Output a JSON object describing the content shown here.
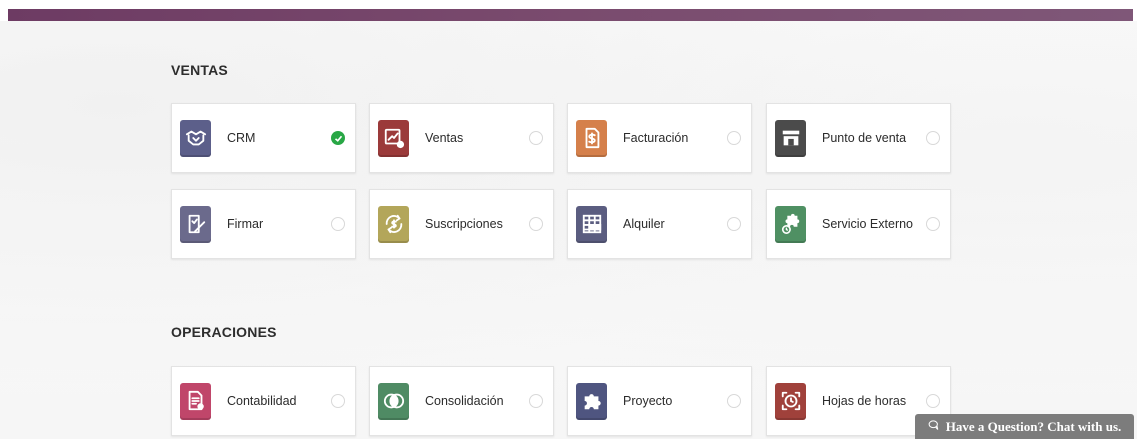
{
  "sections": [
    {
      "title": "VENTAS"
    },
    {
      "title": "OPERACIONES"
    }
  ],
  "apps": {
    "crm": {
      "label": "CRM",
      "installed": true,
      "icon": "handshake-icon",
      "color": "#5c5f8a"
    },
    "ventas": {
      "label": "Ventas",
      "installed": false,
      "icon": "chart-up-icon",
      "color": "#9b3a3a"
    },
    "facturacion": {
      "label": "Facturación",
      "installed": false,
      "icon": "invoice-icon",
      "color": "#d5804b"
    },
    "punto_venta": {
      "label": "Punto de venta",
      "installed": false,
      "icon": "store-icon",
      "color": "#4b4b4b"
    },
    "firmar": {
      "label": "Firmar",
      "installed": false,
      "icon": "sign-document-icon",
      "color": "#6b6a8c"
    },
    "suscripciones": {
      "label": "Suscripciones",
      "installed": false,
      "icon": "subscription-icon",
      "color": "#b3a65a"
    },
    "alquiler": {
      "label": "Alquiler",
      "installed": false,
      "icon": "calendar-grid-icon",
      "color": "#5b5d80"
    },
    "servicio_externo": {
      "label": "Servicio Externo",
      "installed": false,
      "icon": "puzzle-clock-icon",
      "color": "#4f9063"
    },
    "contabilidad": {
      "label": "Contabilidad",
      "installed": false,
      "icon": "accounting-doc-icon",
      "color": "#c0466a"
    },
    "consolidacion": {
      "label": "Consolidación",
      "installed": false,
      "icon": "overlap-circles-icon",
      "color": "#4f8b64"
    },
    "proyecto": {
      "label": "Proyecto",
      "installed": false,
      "icon": "puzzle-icon",
      "color": "#4f5580"
    },
    "hojas_horas": {
      "label": "Hojas de horas",
      "installed": false,
      "icon": "timer-icon",
      "color": "#a0413b"
    }
  },
  "chat": {
    "label": "Have a Question? Chat with us.",
    "icon": "chat-bubble-icon"
  }
}
